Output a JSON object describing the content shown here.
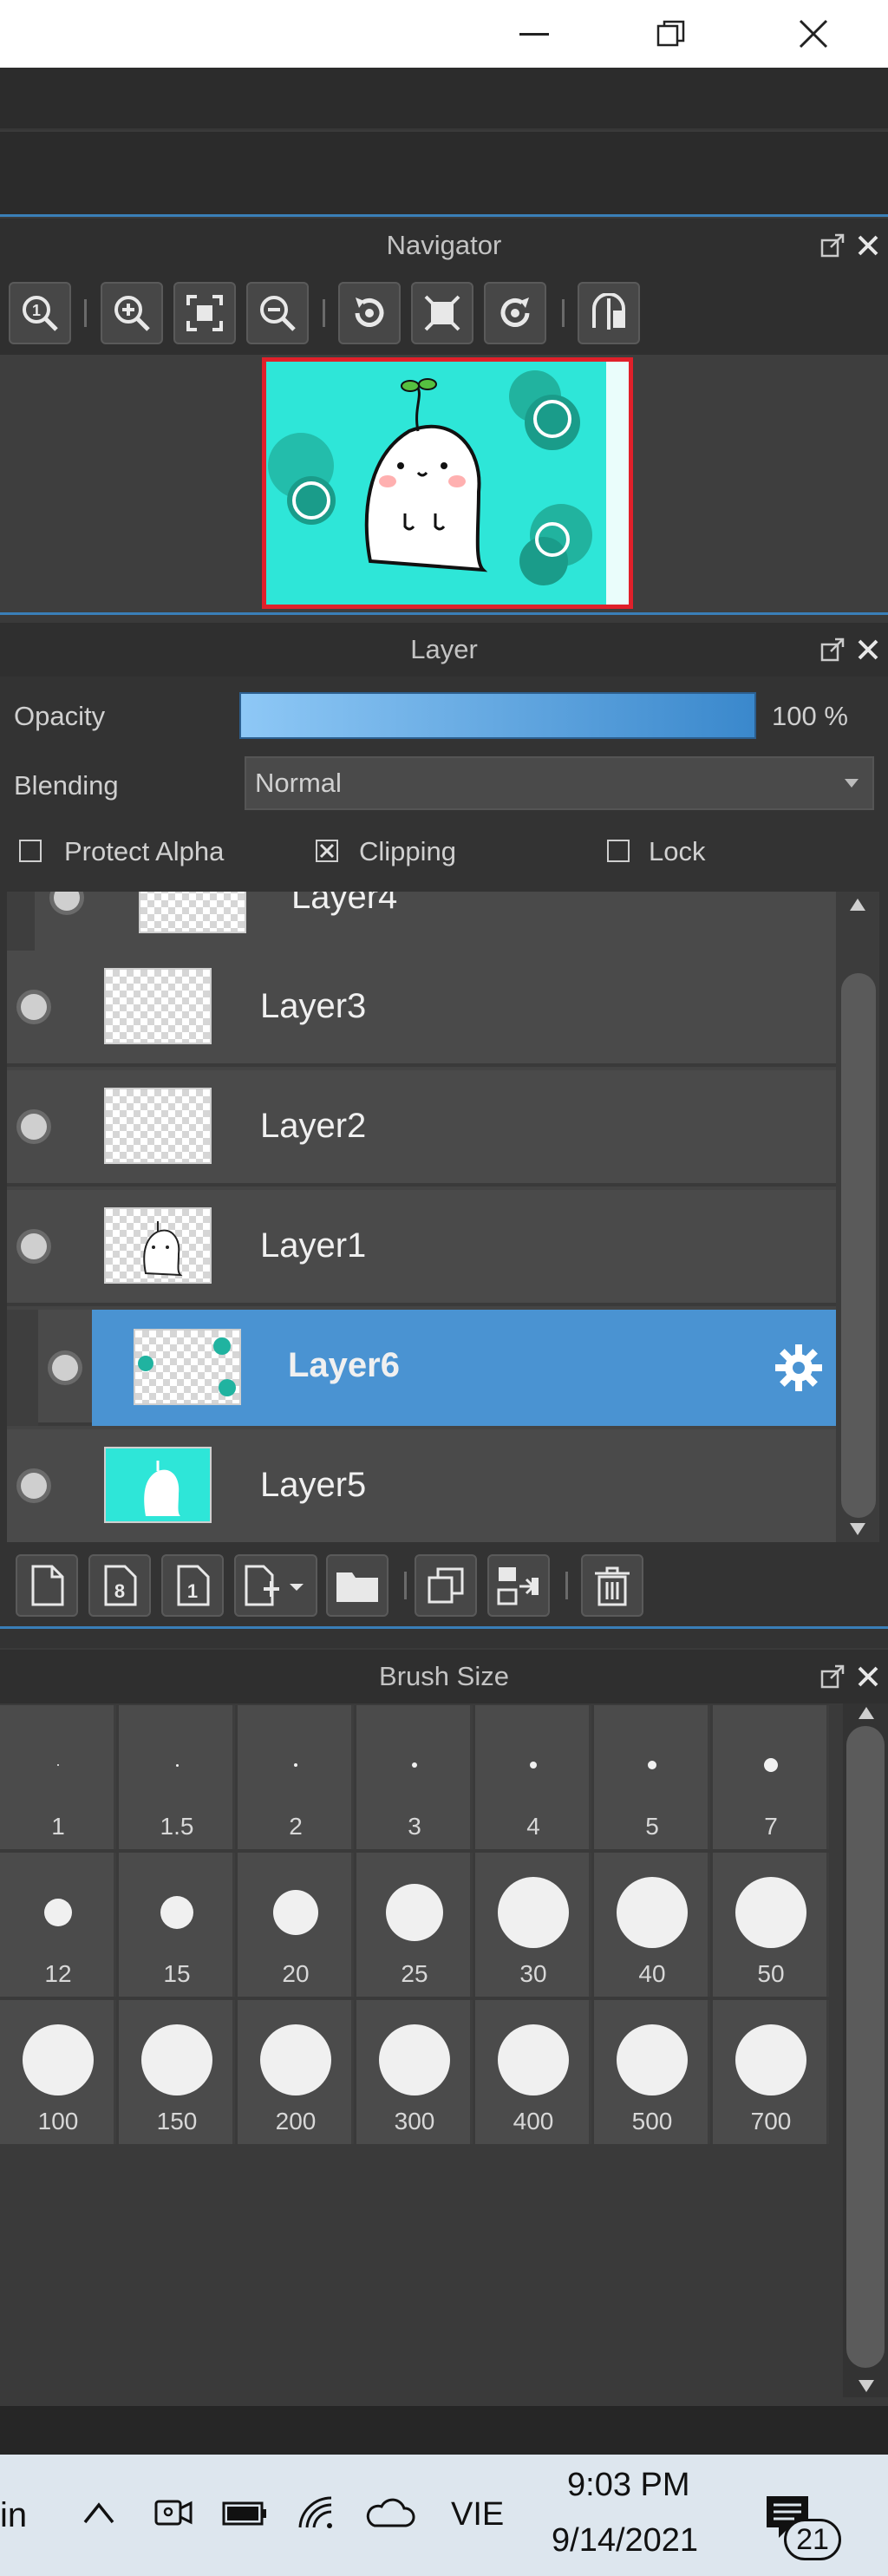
{
  "window": {
    "minimize_glyph": "—",
    "maximize_glyph": "❐",
    "close_glyph": "✕"
  },
  "navigator": {
    "title": "Navigator",
    "toolbar": [
      "zoom-actual-icon",
      "zoom-in-icon",
      "fit-screen-icon",
      "zoom-out-icon",
      "rotate-left-icon",
      "fit-window-icon",
      "rotate-right-icon",
      "flip-horizontal-icon"
    ]
  },
  "layer": {
    "title": "Layer",
    "opacity_label": "Opacity",
    "opacity_value": "100 %",
    "opacity": 1.0,
    "blending_label": "Blending",
    "blending_value": "Normal",
    "protect_alpha_label": "Protect Alpha",
    "clipping_label": "Clipping",
    "lock_label": "Lock",
    "protect_alpha_checked": false,
    "clipping_checked": true,
    "lock_checked": false,
    "layers": [
      {
        "name": "Layer4",
        "selected": false,
        "partial": true
      },
      {
        "name": "Layer3",
        "selected": false
      },
      {
        "name": "Layer2",
        "selected": false
      },
      {
        "name": "Layer1",
        "selected": false
      },
      {
        "name": "Layer6",
        "selected": true,
        "clipped": true
      },
      {
        "name": "Layer5",
        "selected": false
      }
    ],
    "toolbar": [
      "new-layer-icon",
      "new-8bit-layer-icon",
      "new-1bit-layer-icon",
      "add-layer-menu-icon",
      "folder-icon",
      "duplicate-layer-icon",
      "merge-layer-icon",
      "delete-layer-icon"
    ]
  },
  "brush_size": {
    "title": "Brush Size",
    "rows": [
      [
        "1",
        "1.5",
        "2",
        "3",
        "4",
        "5",
        "7"
      ],
      [
        "12",
        "15",
        "20",
        "25",
        "30",
        "40",
        "50"
      ],
      [
        "100",
        "150",
        "200",
        "300",
        "400",
        "500",
        "700"
      ]
    ]
  },
  "taskbar": {
    "partial_text": "in",
    "language": "VIE",
    "time": "9:03 PM",
    "date": "9/14/2021",
    "notification_count": "21"
  },
  "colors": {
    "accent": "#4a93d2",
    "panel_bg": "#333333",
    "thumb_cyan": "#2ee6d8"
  }
}
